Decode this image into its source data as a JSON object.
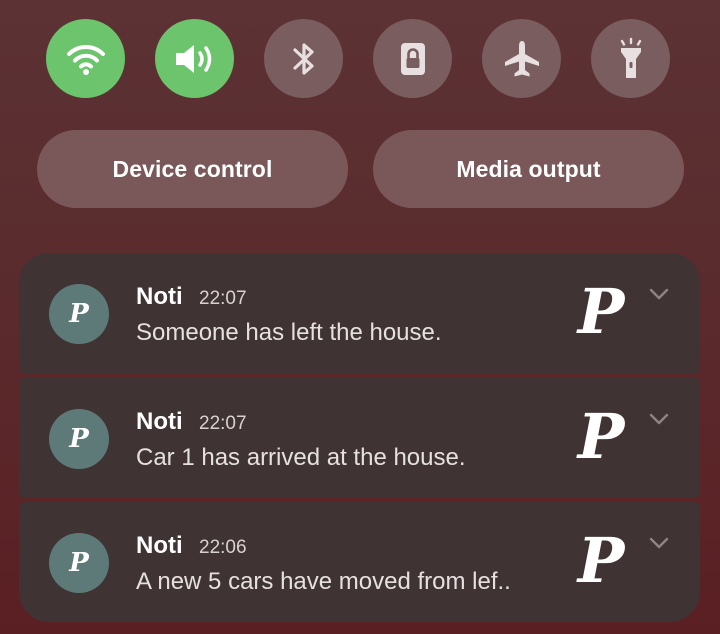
{
  "quick_settings": {
    "toggles": [
      {
        "name": "wifi",
        "icon": "wifi-icon",
        "state": "on"
      },
      {
        "name": "sound",
        "icon": "volume-icon",
        "state": "on"
      },
      {
        "name": "bluetooth",
        "icon": "bluetooth-icon",
        "state": "off"
      },
      {
        "name": "lock",
        "icon": "lock-icon",
        "state": "off"
      },
      {
        "name": "airplane",
        "icon": "airplane-icon",
        "state": "off"
      },
      {
        "name": "flashlight",
        "icon": "flashlight-icon",
        "state": "off"
      }
    ],
    "device_control_label": "Device control",
    "media_output_label": "Media output"
  },
  "notifications": [
    {
      "app": "Noti",
      "time": "22:07",
      "message": "Someone has left the house.",
      "avatar_letter": "P",
      "large_icon_letter": "P"
    },
    {
      "app": "Noti",
      "time": "22:07",
      "message": "Car 1 has arrived at the house.",
      "avatar_letter": "P",
      "large_icon_letter": "P"
    },
    {
      "app": "Noti",
      "time": "22:06",
      "message": "A new 5 cars have moved from lef..",
      "avatar_letter": "P",
      "large_icon_letter": "P"
    }
  ],
  "colors": {
    "toggle_on": "#6cc46d",
    "toggle_off": "#7a5d5e",
    "pill": "#7a5758",
    "card": "#3f3333",
    "avatar": "#5e7a78"
  }
}
